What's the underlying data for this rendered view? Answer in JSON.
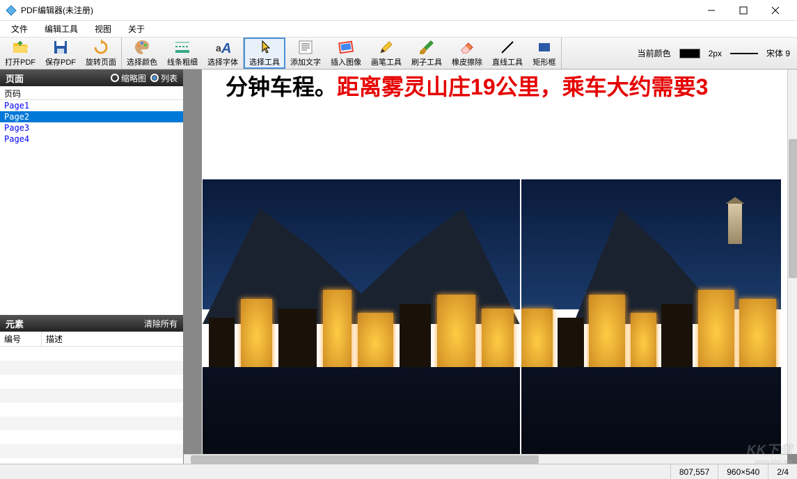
{
  "titlebar": {
    "title": "PDF编辑器(未注册)"
  },
  "menubar": {
    "items": [
      "文件",
      "编辑工具",
      "视图",
      "关于"
    ]
  },
  "toolbar": {
    "groups": [
      [
        {
          "key": "open",
          "label": "打开PDF",
          "icon": "folder-open"
        },
        {
          "key": "save",
          "label": "保存PDF",
          "icon": "save"
        },
        {
          "key": "rotate",
          "label": "旋转页面",
          "icon": "rotate"
        }
      ],
      [
        {
          "key": "color",
          "label": "选择颜色",
          "icon": "palette"
        },
        {
          "key": "linew",
          "label": "线条粗细",
          "icon": "line-weight"
        },
        {
          "key": "font",
          "label": "选择字体",
          "icon": "font"
        }
      ],
      [
        {
          "key": "select",
          "label": "选择工具",
          "icon": "pointer",
          "selected": true
        },
        {
          "key": "text",
          "label": "添加文字",
          "icon": "text-lines"
        },
        {
          "key": "image",
          "label": "插入图像",
          "icon": "image"
        },
        {
          "key": "pen",
          "label": "画笔工具",
          "icon": "pencil"
        },
        {
          "key": "brush",
          "label": "刷子工具",
          "icon": "brush"
        },
        {
          "key": "eraser",
          "label": "橡皮擦除",
          "icon": "eraser"
        },
        {
          "key": "line",
          "label": "直线工具",
          "icon": "line"
        },
        {
          "key": "rect",
          "label": "矩形框",
          "icon": "rect"
        }
      ]
    ],
    "right": {
      "color_label": "当前颜色",
      "stroke_label": "2px",
      "font_label": "宋体 9"
    }
  },
  "sidebar": {
    "pages_title": "页面",
    "view_thumb": "缩略图",
    "view_list": "列表",
    "col_page": "页码",
    "items": [
      "Page1",
      "Page2",
      "Page3",
      "Page4"
    ],
    "selected_index": 1,
    "elements_title": "元素",
    "clear_all": "清除所有",
    "col_id": "编号",
    "col_desc": "描述"
  },
  "document": {
    "line_black": "分钟车程。",
    "line_red": "距离雾灵山庄19公里，乘车大约需要3"
  },
  "statusbar": {
    "coords": "807,557",
    "dims": "960×540",
    "page": "2/4"
  },
  "watermark": {
    "big": "KK下载",
    "small": "www.kkx.net"
  }
}
